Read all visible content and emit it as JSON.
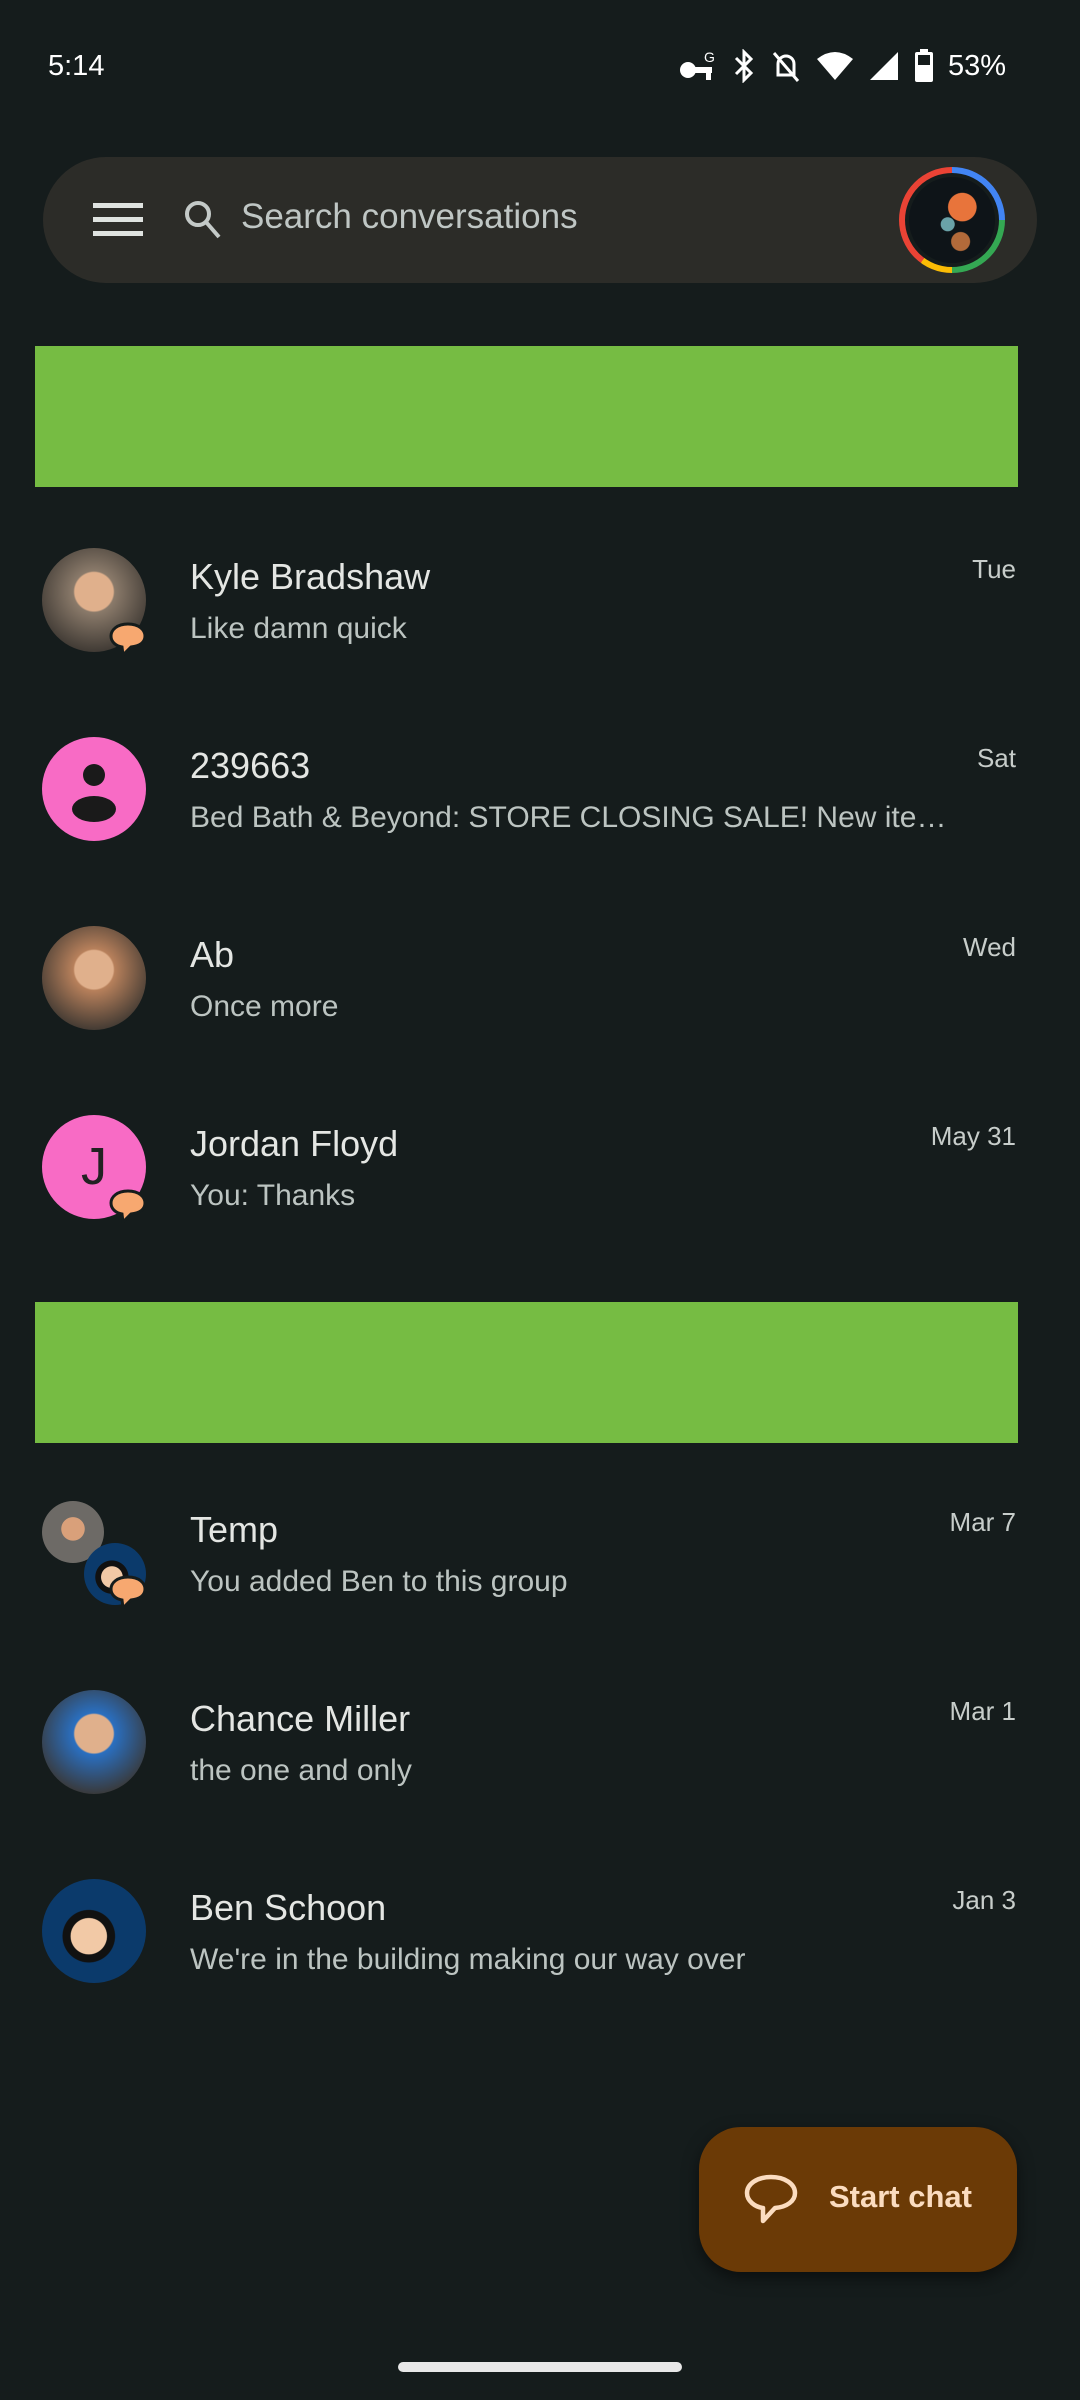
{
  "status_bar": {
    "time": "5:14",
    "battery": "53%",
    "icons": [
      "vpn-key-icon",
      "bluetooth-icon",
      "notifications-off-icon",
      "wifi-icon",
      "cell-signal-icon",
      "battery-icon"
    ]
  },
  "search": {
    "placeholder": "Search conversations",
    "menu_icon": "hamburger-menu-icon",
    "search_icon": "search-icon",
    "account_icon": "account-avatar"
  },
  "conversations": [
    {
      "name": "Kyle Bradshaw",
      "message": "Like damn quick",
      "date": "Tue",
      "avatar": "photo",
      "avatar_color": "#8a7a6a",
      "rcs_badge": true
    },
    {
      "name": "239663",
      "message": "Bed Bath & Beyond: STORE CLOSING SALE! New ite…",
      "date": "Sat",
      "avatar": "person-icon",
      "avatar_color": "#f86bc5",
      "rcs_badge": false
    },
    {
      "name": "Ab",
      "message": "Once more",
      "date": "Wed",
      "avatar": "photo",
      "avatar_color": "#b7805b",
      "rcs_badge": false
    },
    {
      "name": "Jordan Floyd",
      "message": "You: Thanks",
      "date": "May 31",
      "avatar": "J",
      "avatar_color": "#f86bc5",
      "rcs_badge": true
    },
    {
      "name": "Temp",
      "message": "You added Ben to this group",
      "date": "Mar 7",
      "avatar": "group",
      "avatar_color": "#0b3a6b",
      "rcs_badge": true
    },
    {
      "name": "Chance Miller",
      "message": "the one and only",
      "date": "Mar 1",
      "avatar": "photo",
      "avatar_color": "#2a6fc0",
      "rcs_badge": false
    },
    {
      "name": "Ben Schoon",
      "message": "We're in the building making our way over",
      "date": "Jan 3",
      "avatar": "illustration",
      "avatar_color": "#0b3a6b",
      "rcs_badge": false
    }
  ],
  "fab": {
    "label": "Start chat",
    "icon": "chat-bubble-icon"
  },
  "colors": {
    "background": "#151c1c",
    "banner": "#76bc43",
    "fab": "#6b3a06",
    "badge": "#f7a870"
  }
}
